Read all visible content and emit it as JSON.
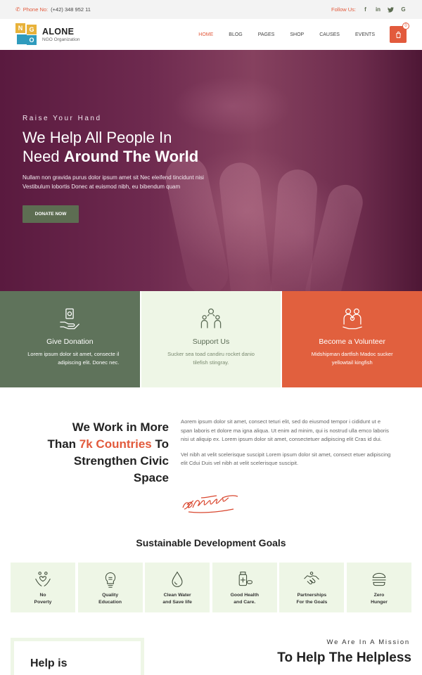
{
  "topbar": {
    "phone_label": "Phone No:",
    "phone_number": "(+42) 348 952 11",
    "follow_label": "Follow Us:",
    "social": [
      "facebook-icon",
      "linkedin-icon",
      "twitter-icon",
      "google-icon"
    ]
  },
  "header": {
    "logo_letters": [
      "N",
      "G",
      "O"
    ],
    "logo_name": "ALONE",
    "logo_sub": "NGO Organization",
    "nav": [
      "HOME",
      "BLOG",
      "PAGES",
      "SHOP",
      "CAUSES",
      "EVENTS"
    ],
    "active_nav": "HOME",
    "cart_count": "0"
  },
  "hero": {
    "eyebrow": "Raise Your Hand",
    "title_line1": "We Help All People In",
    "title_line2_plain": "Need ",
    "title_line2_bold": "Around The World",
    "desc_line1": "Nullam non gravida purus dolor ipsum amet sit Nec eleifend tincidunt nisi",
    "desc_line2": "Vestibulum lobortis Donec at euismod nibh, eu bibendum quam",
    "button": "DONATE NOW"
  },
  "features": [
    {
      "title": "Give Donation",
      "desc": "Lorem ipsum dolor sit amet, consecte il adipiscing elit. Donec nec.",
      "icon": "donation-hand-icon"
    },
    {
      "title": "Support Us",
      "desc": "Sucker sea toad candiru rocket danio tilefish stingray.",
      "icon": "support-people-icon"
    },
    {
      "title": "Become a Volunteer",
      "desc": "Midshipman dartfish Madoc sucker yellowtail kingfish",
      "icon": "volunteer-family-icon"
    }
  ],
  "about": {
    "heading_line1": "We Work in More",
    "heading_plain2": "Than ",
    "heading_accent": "7k Countries",
    "heading_rest2": " To",
    "heading_line3": "Strengthen Civic",
    "heading_line4": "Space",
    "para1": "Aorem ipsum dolor sit amet, consect teturi elit, sed do eiusmod tempor i cididunt ut e span laboris et dolore ma igna aliqua. Ut enim ad minim, qui is nostrud ulla emco laboris nisi ut aliquip ex. Lorem ipsum dolor sit amet, consectetuer adipiscing elit Cras id dui.",
    "para2": "Vel nibh at velit scelerisque suscipit Lorem ipsum dolor sit amet, consect etuer adipiscing elit Cdui Duis vel nibh at velit scelerisque suscipit."
  },
  "sdg": {
    "title": "Sustainable Development Goals",
    "items": [
      {
        "label": "No\nPoverty",
        "icon": "hands-heart-icon"
      },
      {
        "label": "Quality\nEducation",
        "icon": "lightbulb-icon"
      },
      {
        "label": "Clean Water\nand Save life",
        "icon": "water-drop-icon"
      },
      {
        "label": "Good Health\nand Care.",
        "icon": "medicine-icon"
      },
      {
        "label": "Partnerships\nFor the Goals",
        "icon": "handshake-icon"
      },
      {
        "label": "Zero\nHunger",
        "icon": "burger-icon"
      }
    ]
  },
  "bottom": {
    "help_text": "Help is",
    "mission_eyebrow": "We Are In A Mission",
    "mission_title": "To Help The Helpless"
  },
  "colors": {
    "accent": "#e25a3c",
    "green": "#5f735b",
    "light_green": "#eef6e6",
    "hero": "#6e2a4f"
  }
}
